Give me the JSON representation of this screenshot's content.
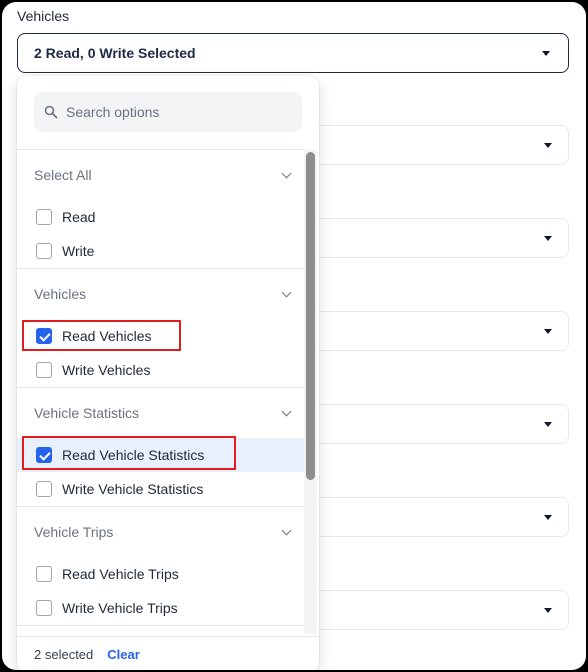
{
  "field": {
    "label": "Vehicles",
    "selected_summary": "2 Read, 0 Write Selected"
  },
  "search": {
    "placeholder": "Search options"
  },
  "groups": [
    {
      "title": "Select All",
      "options": [
        {
          "label": "Read",
          "checked": false
        },
        {
          "label": "Write",
          "checked": false
        }
      ]
    },
    {
      "title": "Vehicles",
      "options": [
        {
          "label": "Read Vehicles",
          "checked": true
        },
        {
          "label": "Write Vehicles",
          "checked": false
        }
      ]
    },
    {
      "title": "Vehicle Statistics",
      "options": [
        {
          "label": "Read Vehicle Statistics",
          "checked": true
        },
        {
          "label": "Write Vehicle Statistics",
          "checked": false
        }
      ]
    },
    {
      "title": "Vehicle Trips",
      "options": [
        {
          "label": "Read Vehicle Trips",
          "checked": false
        },
        {
          "label": "Write Vehicle Trips",
          "checked": false
        }
      ]
    }
  ],
  "footer": {
    "count_text": "2 selected",
    "clear_label": "Clear"
  },
  "colors": {
    "accent": "#2563eb",
    "highlight": "#e8f0fb",
    "annotation_red": "#e11d1d"
  }
}
